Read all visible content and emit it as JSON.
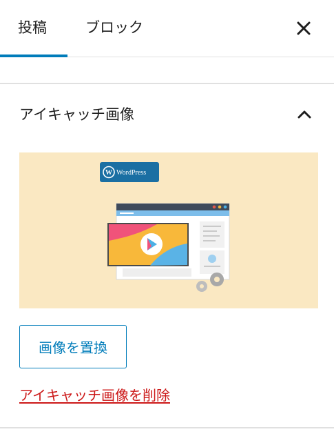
{
  "tabs": [
    {
      "label": "投稿",
      "active": true
    },
    {
      "label": "ブロック",
      "active": false
    }
  ],
  "close_icon": "close-icon",
  "panel": {
    "title": "アイキャッチ画像",
    "toggle_icon": "chevron-up-icon",
    "image_logo_text": "WordPress",
    "replace_label": "画像を置換",
    "remove_label": "アイキャッチ画像を削除"
  },
  "colors": {
    "accent": "#007cba",
    "danger": "#cc1818",
    "preview_bg": "#fae8c2",
    "divider": "#e0e0e0"
  }
}
